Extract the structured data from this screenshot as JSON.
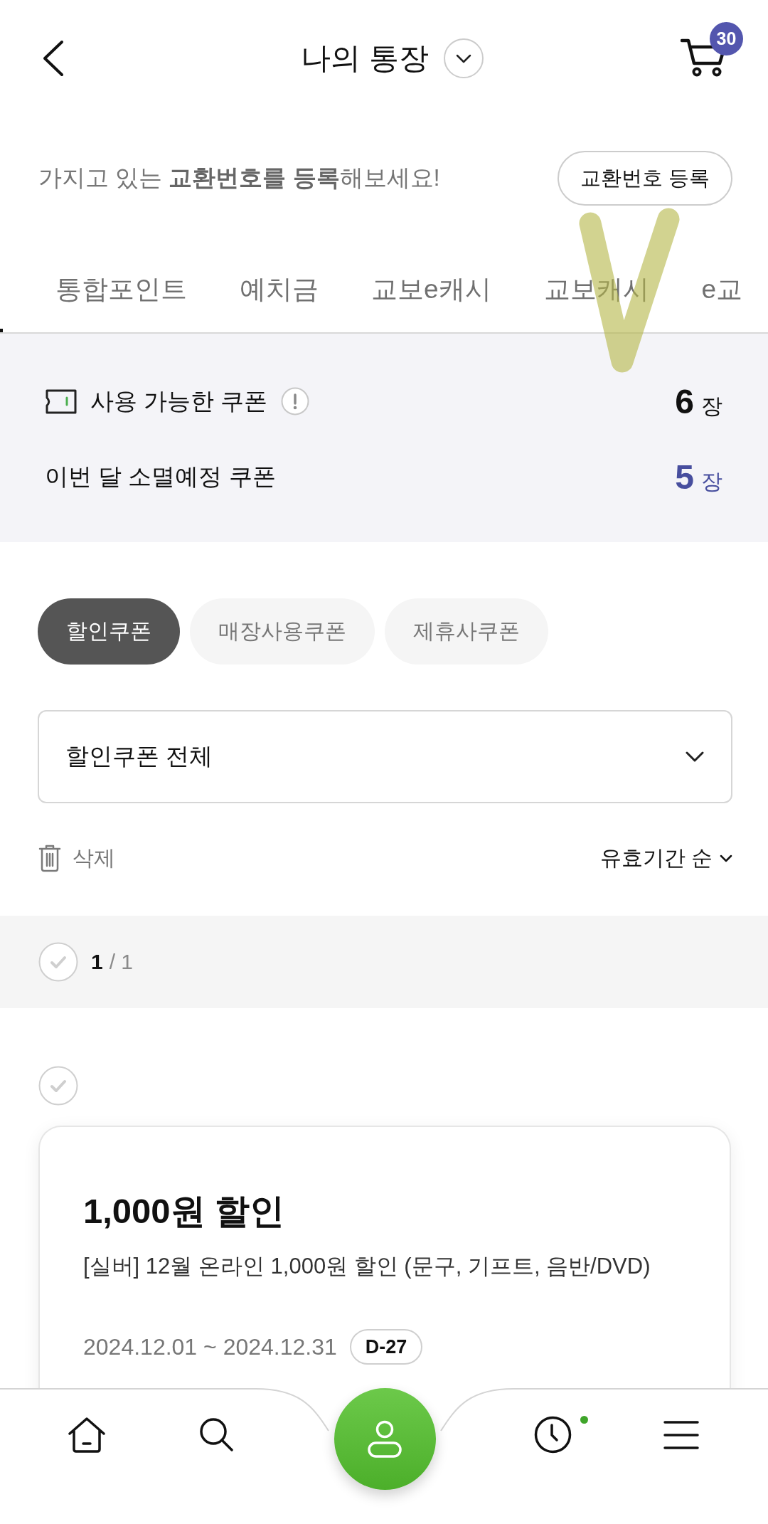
{
  "header": {
    "title": "나의 통장",
    "cart_badge": "30"
  },
  "register": {
    "message": "가지고 있는 **교환번호를 등록**해보세요!",
    "button": "교환번호 등록"
  },
  "tabs": [
    {
      "label": "통합포인트",
      "selected": false
    },
    {
      "label": "예치금",
      "selected": false
    },
    {
      "label": "교보e캐시",
      "selected": false
    },
    {
      "label": "교보캐시",
      "selected": false
    },
    {
      "label": "e교",
      "selected": false
    }
  ],
  "summary": [
    {
      "kind": "available",
      "label": "사용 가능한 쿠폰",
      "count": "6",
      "unit": "장"
    },
    {
      "kind": "expiring",
      "label": "이번 달 소멸예정 쿠폰",
      "count": "5",
      "unit": "장"
    }
  ],
  "chips": [
    {
      "label": "할인쿠폰",
      "selected": true
    },
    {
      "label": "매장사용쿠폰",
      "selected": false
    },
    {
      "label": "제휴사쿠폰",
      "selected": false
    }
  ],
  "filter_select": {
    "value": "할인쿠폰 전체"
  },
  "toolbar": {
    "delete": "삭제",
    "sort": "유효기간 순"
  },
  "count_bar": {
    "checked": false,
    "picked_count": "1",
    "total_count": "/ 1"
  },
  "coupons": [
    {
      "checked": false,
      "title": "1,000원 할인",
      "description": "[실버] 12월 온라인 1,000원 할인 (문구, 기프트, 음반/DVD)",
      "period": "2024.12.01 ~ 2024.12.31",
      "d_day": "D-27"
    }
  ],
  "bottom_nav": [
    {
      "kind": "home",
      "notification_dot": false
    },
    {
      "kind": "search",
      "notification_dot": false
    },
    {
      "kind": "profile",
      "notification_dot": false
    },
    {
      "kind": "history",
      "notification_dot": true
    },
    {
      "kind": "menu",
      "notification_dot": false
    }
  ]
}
